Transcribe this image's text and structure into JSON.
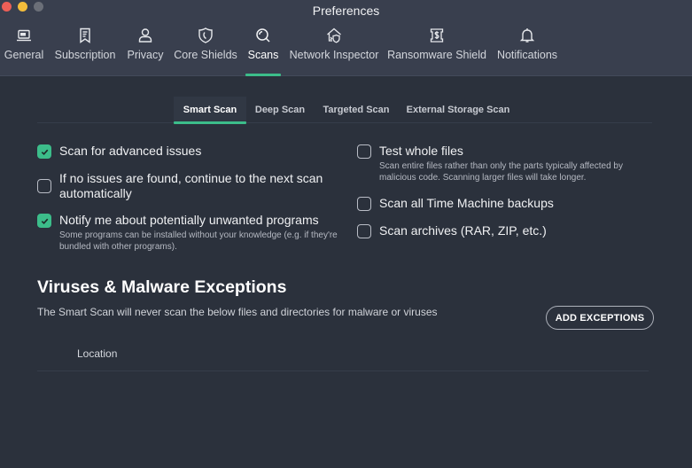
{
  "window": {
    "title": "Preferences",
    "traffic_lights": [
      "close",
      "minimize",
      "zoom"
    ]
  },
  "nav": {
    "active": "Scans",
    "items": [
      {
        "label": "General",
        "icon": "laptop-icon"
      },
      {
        "label": "Subscription",
        "icon": "receipt-bookmark-icon"
      },
      {
        "label": "Privacy",
        "icon": "user-icon"
      },
      {
        "label": "Core Shields",
        "icon": "shield-icon"
      },
      {
        "label": "Scans",
        "icon": "magnifier-icon"
      },
      {
        "label": "Network Inspector",
        "icon": "home-network-shield-icon"
      },
      {
        "label": "Ransomware Shield",
        "icon": "dollar-file-icon"
      },
      {
        "label": "Notifications",
        "icon": "bell-icon"
      }
    ]
  },
  "subtabs": {
    "active": "Smart Scan",
    "items": [
      "Smart Scan",
      "Deep Scan",
      "Targeted Scan",
      "External Storage Scan"
    ]
  },
  "options": {
    "left": [
      {
        "label": "Scan for advanced issues",
        "checked": true,
        "description": ""
      },
      {
        "label": "If no issues are found, continue to the next scan automatically",
        "checked": false,
        "description": ""
      },
      {
        "label": "Notify me about potentially unwanted programs",
        "checked": true,
        "description": "Some programs can be installed without your knowledge (e.g. if they're bundled with other programs)."
      }
    ],
    "right": [
      {
        "label": "Test whole files",
        "checked": false,
        "description": "Scan entire files rather than only the parts typically affected by malicious code. Scanning larger files will take longer."
      },
      {
        "label": "Scan all Time Machine backups",
        "checked": false,
        "description": ""
      },
      {
        "label": "Scan archives (RAR, ZIP, etc.)",
        "checked": false,
        "description": ""
      }
    ]
  },
  "exceptions": {
    "title": "Viruses & Malware Exceptions",
    "description": "The Smart Scan will never scan the below files and directories for malware or viruses",
    "add_button": "ADD EXCEPTIONS",
    "columns": [
      "Location"
    ],
    "rows": []
  },
  "colors": {
    "accent": "#3cbd8a",
    "titlebar": "#393f4e",
    "background": "#2b313c"
  }
}
